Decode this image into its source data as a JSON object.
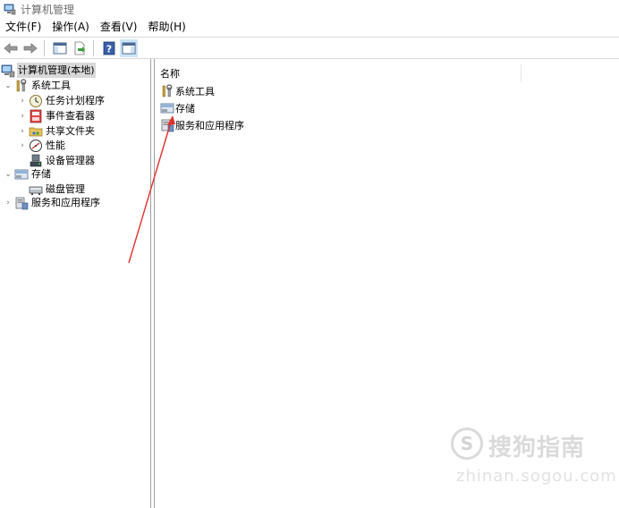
{
  "window": {
    "title": "计算机管理"
  },
  "menu": [
    {
      "label": "文件(F)"
    },
    {
      "label": "操作(A)"
    },
    {
      "label": "查看(V)"
    },
    {
      "label": "帮助(H)"
    }
  ],
  "toolbar": {
    "buttons": [
      {
        "icon": "back-arrow-icon"
      },
      {
        "icon": "forward-arrow-icon"
      },
      {
        "icon": "show-hide-console-tree-icon"
      },
      {
        "icon": "export-list-icon"
      },
      {
        "icon": "help-icon"
      },
      {
        "icon": "show-hide-action-pane-icon"
      }
    ]
  },
  "tree": {
    "root": "计算机管理(本地)",
    "system_tools": "系统工具",
    "task_scheduler": "任务计划程序",
    "event_viewer": "事件查看器",
    "shared_folders": "共享文件夹",
    "performance": "性能",
    "device_manager": "设备管理器",
    "storage": "存储",
    "disk_management": "磁盘管理",
    "services_apps": "服务和应用程序"
  },
  "list": {
    "column_name": "名称",
    "items": [
      {
        "label": "系统工具",
        "icon": "system-tools-icon"
      },
      {
        "label": "存储",
        "icon": "storage-icon"
      },
      {
        "label": "服务和应用程序",
        "icon": "services-apps-icon"
      }
    ]
  },
  "watermark": {
    "logo": "S",
    "text": "搜狗指南",
    "sub": "zhinan.sogou.com"
  },
  "colors": {
    "annotation_arrow": "#e0312c",
    "selection": "#d9d9d9",
    "title_text": "#6b6b6b"
  }
}
